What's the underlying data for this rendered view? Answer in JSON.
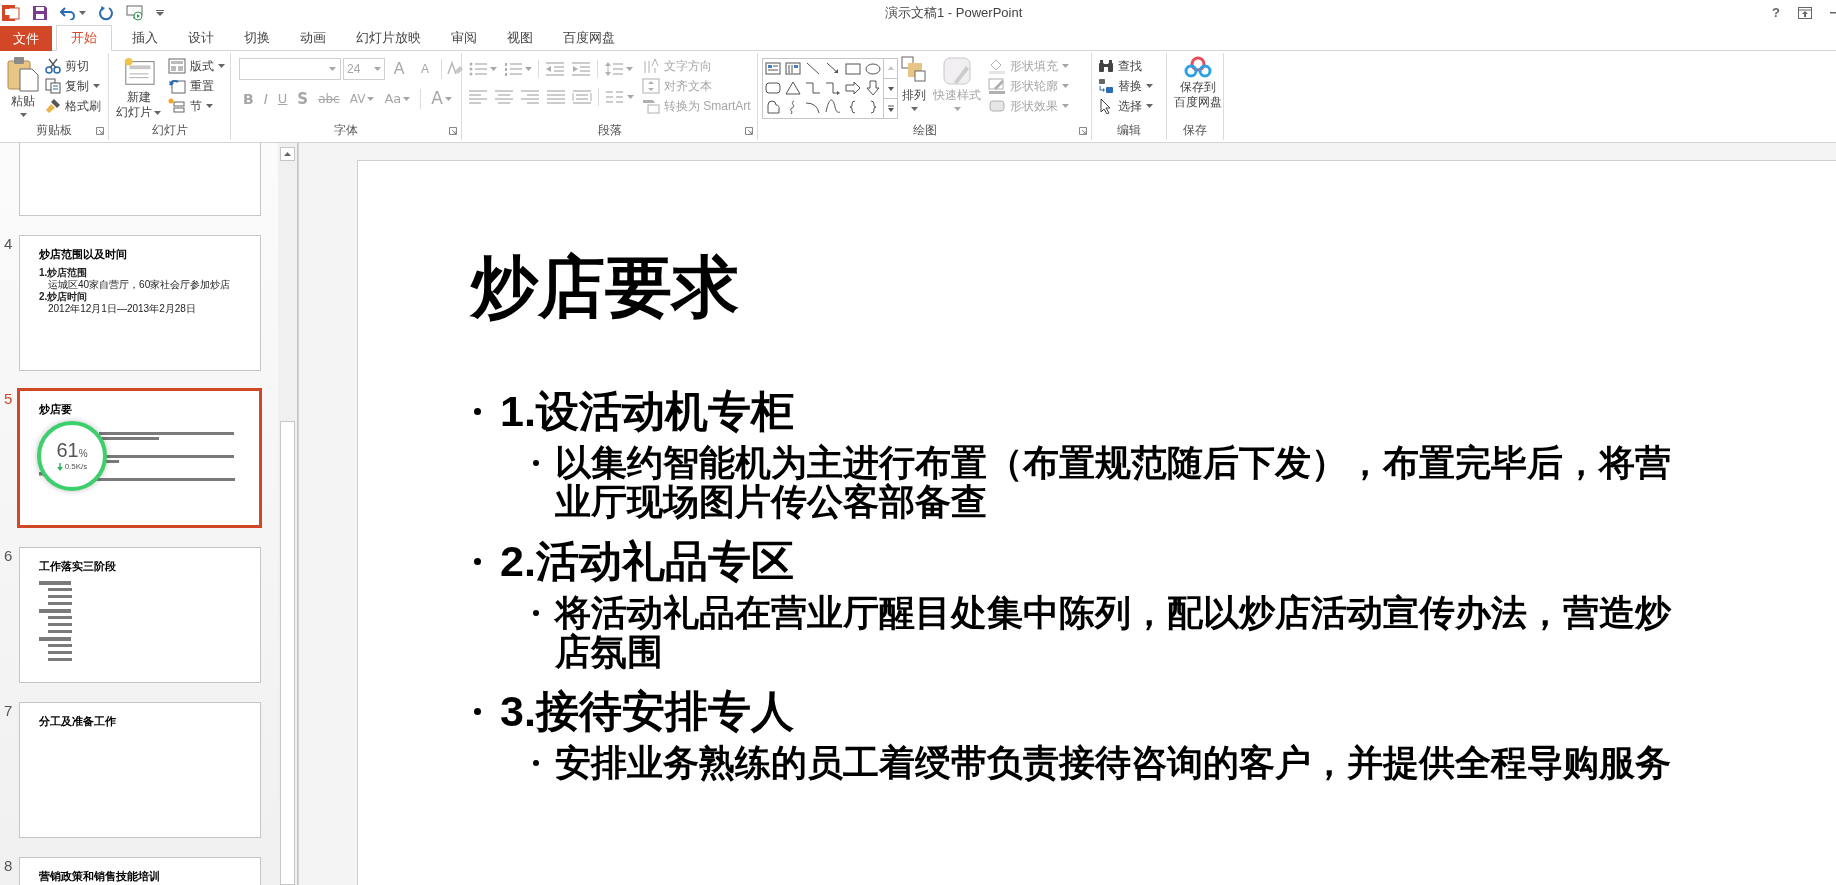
{
  "window": {
    "title": "演示文稿1 - PowerPoint",
    "help": "?"
  },
  "tabs": [
    {
      "label": "文件",
      "kind": "file",
      "selected": false
    },
    {
      "label": "开始",
      "kind": "tab",
      "selected": true
    },
    {
      "label": "插入",
      "kind": "tab",
      "selected": false
    },
    {
      "label": "设计",
      "kind": "tab",
      "selected": false
    },
    {
      "label": "切换",
      "kind": "tab",
      "selected": false
    },
    {
      "label": "动画",
      "kind": "tab",
      "selected": false
    },
    {
      "label": "幻灯片放映",
      "kind": "tab",
      "selected": false
    },
    {
      "label": "审阅",
      "kind": "tab",
      "selected": false
    },
    {
      "label": "视图",
      "kind": "tab",
      "selected": false
    },
    {
      "label": "百度网盘",
      "kind": "tab",
      "selected": false
    }
  ],
  "ribbon": [
    {
      "kind": "clipboard",
      "label": "剪贴板",
      "launcher": true,
      "large": {
        "lines": [
          "粘贴"
        ]
      },
      "items": [
        {
          "label": "剪切",
          "dropdown": false
        },
        {
          "label": "复制",
          "dropdown": true
        },
        {
          "label": "格式刷",
          "dropdown": false
        }
      ]
    },
    {
      "kind": "slides",
      "label": "幻灯片",
      "launcher": false,
      "large": {
        "lines": [
          "新建",
          "幻灯片"
        ]
      },
      "items": [
        {
          "label": "版式",
          "dropdown": true
        },
        {
          "label": "重置",
          "dropdown": false
        },
        {
          "label": "节",
          "dropdown": true
        }
      ]
    },
    {
      "kind": "font",
      "label": "字体",
      "launcher": true,
      "disabled": true,
      "font_size": "24",
      "size_buttons": [
        "A",
        "A"
      ],
      "format_buttons": [
        "B",
        "I",
        "U",
        "S",
        "abc",
        "AV",
        "Aa",
        "A"
      ]
    },
    {
      "kind": "paragraph",
      "label": "段落",
      "launcher": true,
      "items": [
        {
          "label": "文字方向",
          "disabled": true
        },
        {
          "label": "对齐文本",
          "disabled": true
        },
        {
          "label": "转换为 SmartArt",
          "disabled": true
        }
      ]
    },
    {
      "kind": "drawing",
      "label": "绘图",
      "launcher": true,
      "arrange": {
        "label": "排列",
        "disabled": false
      },
      "quick_styles": {
        "label": "快速样式",
        "disabled": true
      },
      "items": [
        {
          "label": "形状填充",
          "disabled": true
        },
        {
          "label": "形状轮廓",
          "disabled": true
        },
        {
          "label": "形状效果",
          "disabled": true
        }
      ]
    },
    {
      "kind": "editing",
      "label": "编辑",
      "launcher": false,
      "items": [
        {
          "label": "查找",
          "dropdown": false
        },
        {
          "label": "替换",
          "dropdown": true
        },
        {
          "label": "选择",
          "dropdown": true
        }
      ]
    },
    {
      "kind": "save",
      "label": "保存",
      "launcher": false,
      "large": {
        "lines": [
          "保存到",
          "百度网盘"
        ]
      }
    }
  ],
  "thumbnails": [
    {
      "kind": "cropped",
      "selected": false
    },
    {
      "kind": "text",
      "number": "4",
      "title": "炒店范围以及时间",
      "selected": false,
      "bullets": [
        {
          "text": "1.炒店范围",
          "children": [
            {
              "text": "运城区40家自营厅，60家社会厅参加炒店"
            }
          ]
        },
        {
          "text": "2.炒店时间",
          "children": [
            {
              "text": "2012年12月1日—2013年2月28日"
            }
          ]
        }
      ]
    },
    {
      "kind": "long-lines",
      "number": "5",
      "title": "炒店要",
      "selected": true
    },
    {
      "kind": "short-list",
      "number": "6",
      "title": "工作落实三阶段",
      "selected": false
    },
    {
      "kind": "title",
      "number": "7",
      "title": "分工及准备工作",
      "selected": false
    },
    {
      "kind": "title",
      "number": "8",
      "title": "营销政策和销售技能培训",
      "selected": false
    }
  ],
  "download_widget": {
    "percent": "61",
    "unit": "%",
    "speed": "0.5K/s"
  },
  "slide": {
    "title": "炒店要求",
    "bullets": [
      {
        "text": "1.设活动机专柜",
        "children": [
          {
            "text": "以集约智能机为主进行布置（布置规范随后下发），布置完毕后，将营业厅现场图片传公客部备查"
          }
        ]
      },
      {
        "text": "2.活动礼品专区",
        "children": [
          {
            "text": "将活动礼品在营业厅醒目处集中陈列，配以炒店活动宣传办法，营造炒店氛围"
          }
        ]
      },
      {
        "text": "3.接待安排专人",
        "children": [
          {
            "text": "安排业务熟练的员工着绶带负责接待咨询的客户，并提供全程导购服务"
          }
        ]
      }
    ]
  }
}
